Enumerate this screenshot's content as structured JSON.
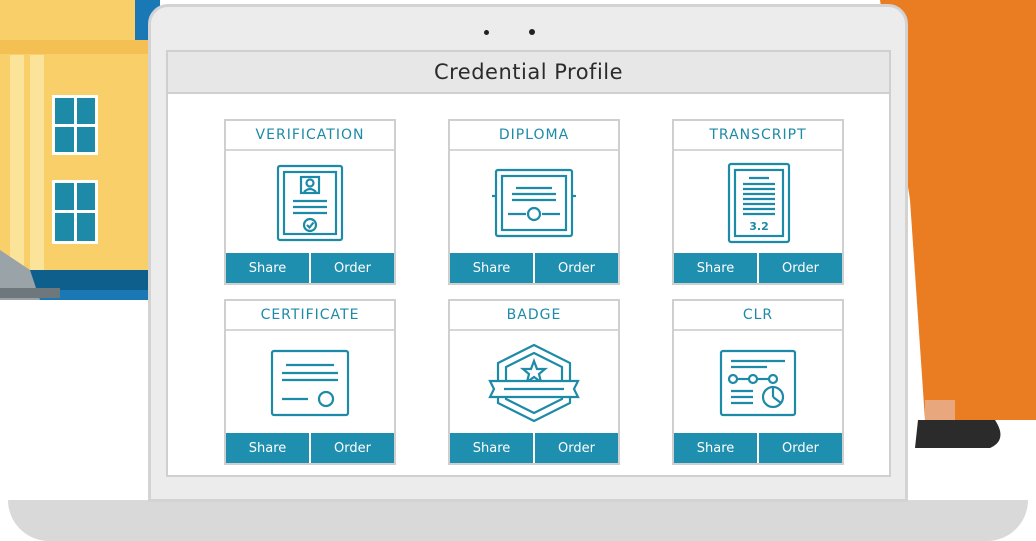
{
  "colors": {
    "accent": "#1e8fae",
    "accent_text": "#1d8aa8",
    "house_wall": "#f9cf6a",
    "house_roof": "#0e5f8c",
    "person_dress": "#ea7c22",
    "sky_blue": "#1a78b5"
  },
  "screen": {
    "title": "Credential Profile"
  },
  "cards": [
    {
      "label": "VERIFICATION",
      "icon": "verification-document-icon",
      "share_label": "Share",
      "order_label": "Order"
    },
    {
      "label": "DIPLOMA",
      "icon": "diploma-icon",
      "share_label": "Share",
      "order_label": "Order"
    },
    {
      "label": "TRANSCRIPT",
      "icon": "transcript-icon",
      "icon_text": "3.2",
      "share_label": "Share",
      "order_label": "Order"
    },
    {
      "label": "CERTIFICATE",
      "icon": "certificate-icon",
      "share_label": "Share",
      "order_label": "Order"
    },
    {
      "label": "BADGE",
      "icon": "badge-star-icon",
      "share_label": "Share",
      "order_label": "Order"
    },
    {
      "label": "CLR",
      "icon": "clr-record-icon",
      "share_label": "Share",
      "order_label": "Order"
    }
  ]
}
